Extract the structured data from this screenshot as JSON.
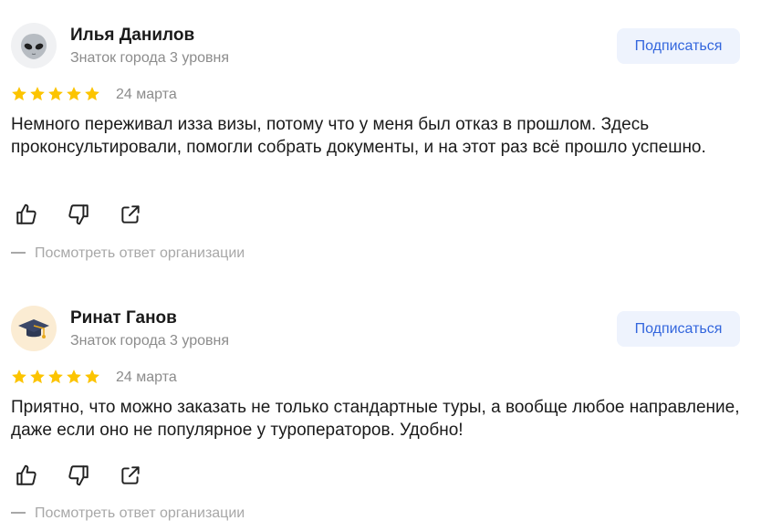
{
  "reviews": [
    {
      "author": "Илья Данилов",
      "badge": "Знаток города 3 уровня",
      "avatar_icon": "alien-icon",
      "subscribe_label": "Подписаться",
      "rating": 5,
      "date": "24 марта",
      "text": "Немного переживал изза визы, потому что у меня был отказ в прошлом. Здесь проконсультировали, помогли собрать документы, и на этот раз всё прошло успешно.",
      "org_answer_label": "Посмотреть ответ организации"
    },
    {
      "author": "Ринат Ганов",
      "badge": "Знаток города 3 уровня",
      "avatar_icon": "graduation-cap-icon",
      "subscribe_label": "Подписаться",
      "rating": 5,
      "date": "24 марта",
      "text": "Приятно, что можно заказать не только стандартные туры, а вообще любое направление, даже если оно не популярное у туроператоров. Удобно!",
      "org_answer_label": "Посмотреть ответ организации"
    }
  ],
  "colors": {
    "star": "#fcc400",
    "accent": "#3366dd",
    "button_bg": "#eef3fd",
    "muted_text": "#8c8c8c",
    "icon": "#222222"
  }
}
